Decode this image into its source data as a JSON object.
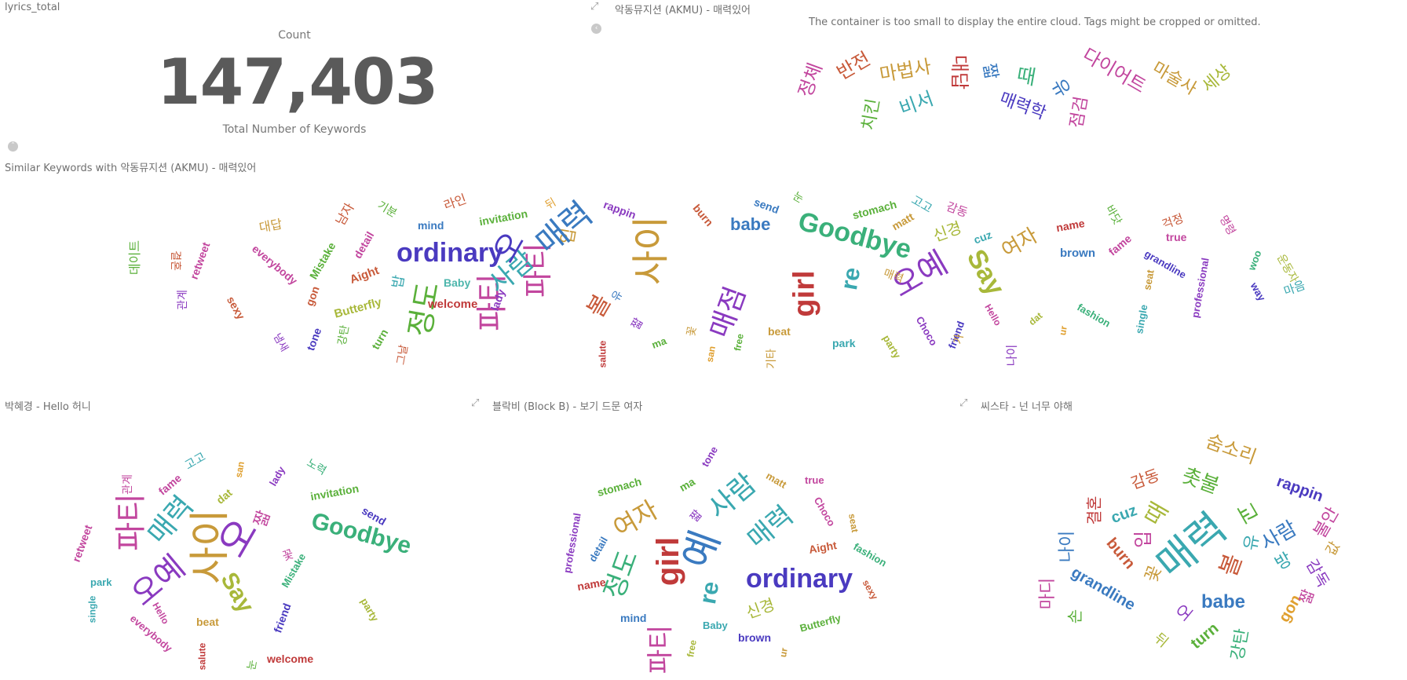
{
  "panels": {
    "lyrics_total": "lyrics_total",
    "akmu": "악동뮤지션 (AKMU) - 매력있어",
    "similar": "Similar Keywords with 악동뮤지션 (AKMU) - 매력있어",
    "park": "박혜경 - Hello 허니",
    "blockb": "블락비 (Block B) - 보기 드문 여자",
    "sistar": "씨스타 - 넌 너무 야해"
  },
  "metric": {
    "count_label": "Count",
    "value": "147,403",
    "subtitle": "Total Number of Keywords"
  },
  "warning": "The container is too small to display the entire cloud. Tags might be cropped or omitted.",
  "icons": {
    "expand": "expand-icon",
    "collapse": "collapse-icon"
  },
  "clouds": {
    "akmu": [
      "정체",
      "반전",
      "마법사",
      "대답",
      "짧",
      "때",
      "유",
      "다이어트",
      "마술사",
      "세상",
      "치킨",
      "비서",
      "매력학",
      "점검"
    ],
    "similar": [
      "데이트",
      "결혼",
      "관계",
      "retweet",
      "sexy",
      "대답",
      "everybody",
      "남자",
      "Mistake",
      "gon",
      "기분",
      "detail",
      "Aight",
      "mind",
      "라인",
      "Butterfly",
      "invitation",
      "뒤",
      "ordinary",
      "정도",
      "파티",
      "입",
      "파티",
      "rappin",
      "Baby",
      "사람",
      "welcome",
      "lady",
      "매력",
      "burn",
      "babe",
      "사이",
      "오",
      "send",
      "눈",
      "Goodbye",
      "girl",
      "re",
      "오예",
      "매점",
      "감동",
      "stomach",
      "matt",
      "고고",
      "cuz",
      "Say",
      "여자",
      "name",
      "brown",
      "fame",
      "grandline",
      "true",
      "professional",
      "woo",
      "걱정",
      "명령",
      "운동자",
      "바닷",
      "salute",
      "ma",
      "꽃",
      "san",
      "free",
      "beat",
      "park",
      "party",
      "Choco",
      "friend",
      "Hello",
      "dat",
      "ur",
      "fashion",
      "single",
      "seat",
      "way",
      "마음",
      "나이",
      "가",
      "기타",
      "매력",
      "밥",
      "tone",
      "turn",
      "그날",
      "강탄",
      "냄새",
      "볼",
      "짧",
      "신경",
      "유"
    ],
    "park": [
      "관계",
      "fame",
      "고고",
      "san",
      "lady",
      "노력",
      "retweet",
      "dat",
      "invitation",
      "send",
      "파티",
      "매력",
      "짧",
      "Goodbye",
      "오예",
      "park",
      "사이",
      "오",
      "Say",
      "Mistake",
      "single",
      "Hello",
      "beat",
      "꽃",
      "friend",
      "party",
      "everybody",
      "salute",
      "welcome",
      "눈"
    ],
    "blockb": [
      "tone",
      "stomach",
      "ma",
      "matt",
      "true",
      "여자",
      "사람",
      "professional",
      "detail",
      "짧",
      "Choco",
      "seat",
      "매력",
      "Aight",
      "fashion",
      "name",
      "정도",
      "girl",
      "예",
      "ordinary",
      "sexy",
      "re",
      "신경",
      "mind",
      "Baby",
      "Butterfly",
      "파티",
      "free",
      "brown",
      "ur"
    ],
    "sistar": [
      "숨소리",
      "감동",
      "촛불",
      "rappin",
      "결혼",
      "cuz",
      "때",
      "매력",
      "나이",
      "교",
      "사람",
      "불안",
      "값",
      "burn",
      "입",
      "유",
      "방",
      "감독",
      "마디",
      "grandline",
      "꽃",
      "babe",
      "볼",
      "손",
      "gon",
      "turn",
      "뒤",
      "강탄",
      "짧",
      "오"
    ]
  },
  "colors": {
    "palette": [
      "#c2469e",
      "#c85a3a",
      "#c89a3a",
      "#a8b83a",
      "#5ab03a",
      "#3ab07a",
      "#3aa8b0",
      "#3a7ac0",
      "#4a3ac0",
      "#8a3ac0",
      "#c03a6a",
      "#4db6ac",
      "#e0a030"
    ]
  }
}
